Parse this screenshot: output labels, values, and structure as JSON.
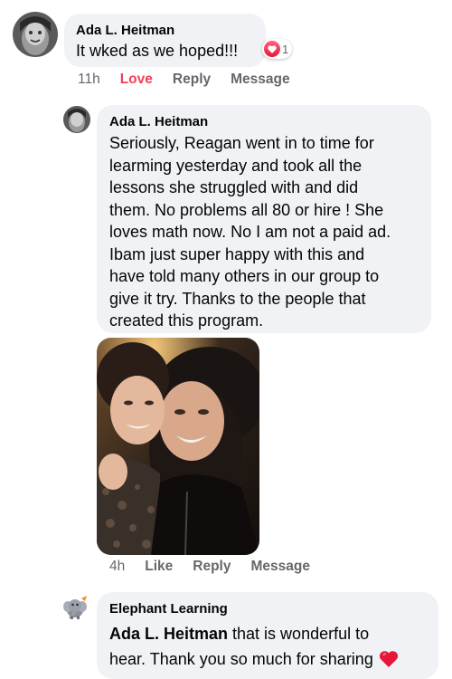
{
  "comment1": {
    "author": "Ada L. Heitman",
    "text": "It wked as we hoped!!!",
    "reaction_count": "1",
    "actions": {
      "time": "11h",
      "love": "Love",
      "reply": "Reply",
      "message": "Message"
    }
  },
  "reply1": {
    "author": "Ada L. Heitman",
    "lines": [
      "Seriously, Reagan went in to time for",
      "learming yesterday and took all the",
      "lessons she struggled with and did",
      "them.  No problems all 80 or hire !  She",
      "loves math now.  No I am not a paid ad.",
      "Ibam just super happy with this and",
      "have told many others in our group to",
      "give it try.  Thanks to the people that",
      "created this program."
    ],
    "actions": {
      "time": "4h",
      "like": "Like",
      "reply": "Reply",
      "message": "Message"
    }
  },
  "reply2": {
    "author": "Elephant Learning",
    "mention": "Ada L. Heitman",
    "text_line1": " that is wonderful to",
    "text_line2": "hear. Thank you so much for sharing"
  },
  "colors": {
    "bubble": "#f0f2f5",
    "love": "#f33e58",
    "muted": "#65676b",
    "heart": "#e61739"
  }
}
